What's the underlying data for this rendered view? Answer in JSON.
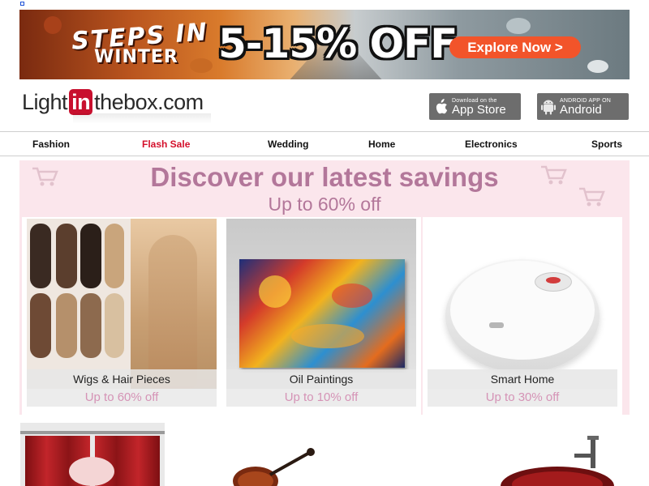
{
  "banner": {
    "headline_line1": "STEPS IN",
    "headline_line2": "WINTER",
    "discount": "5-15% OFF",
    "cta_label": "Explore Now >"
  },
  "header": {
    "logo_left": "Light",
    "logo_in": "in",
    "logo_right": "thebox.com",
    "app_store": {
      "small": "Download on the",
      "big": "App Store"
    },
    "android": {
      "small": "ANDROID APP ON",
      "big": "Android"
    }
  },
  "nav": {
    "items": [
      {
        "label": "Fashion"
      },
      {
        "label": "Flash Sale"
      },
      {
        "label": "Wedding"
      },
      {
        "label": "Home"
      },
      {
        "label": "Electronics"
      },
      {
        "label": "Sports"
      }
    ]
  },
  "savings": {
    "title": "Discover our latest savings",
    "subtitle": "Up to 60% off",
    "cards": [
      {
        "name": "Wigs & Hair Pieces",
        "discount": "Up to 60% off"
      },
      {
        "name": "Oil Paintings",
        "discount": "Up to 10% off"
      },
      {
        "name": "Smart Home",
        "discount": "Up to 30% off"
      }
    ]
  },
  "colors": {
    "brand_red": "#c8102e",
    "flash_sale": "#d4102b",
    "cta_orange": "#f2542a",
    "savings_text": "#b3779a",
    "savings_bg": "#fbe6ec"
  }
}
